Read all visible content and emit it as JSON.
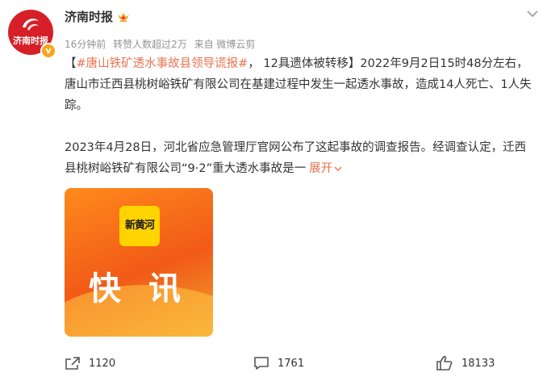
{
  "account": {
    "name": "济南时报",
    "avatar_text": "济南时报"
  },
  "meta": {
    "time": "16分钟前",
    "reposts_note": "转赞人数超过2万",
    "source": "来自 微博云剪"
  },
  "post": {
    "topic": "#唐山铁矿透水事故县领导谎报#",
    "line1_rest": "， 12具遗体被转移】2022年9月2日15时48分左右，唐山市迁西县桃树峪铁矿有限公司在基建过程中发生一起透水事故，造成14人死亡、1人失踪。",
    "para2": "2023年4月28日，河北省应急管理厅官网公布了这起事故的调查报告。经调查认定，迁西县桃树峪铁矿有限公司“9·2”重大透水事故是一",
    "expand_label": "展开",
    "open_bracket": "【"
  },
  "image": {
    "tag_text": "新黄河",
    "headline": "快 讯"
  },
  "actions": {
    "forward_count": "1120",
    "comment_count": "1761",
    "like_count": "18133"
  },
  "colors": {
    "accent": "#eb7350",
    "meta": "#939393",
    "brand_red": "#d61f26"
  }
}
